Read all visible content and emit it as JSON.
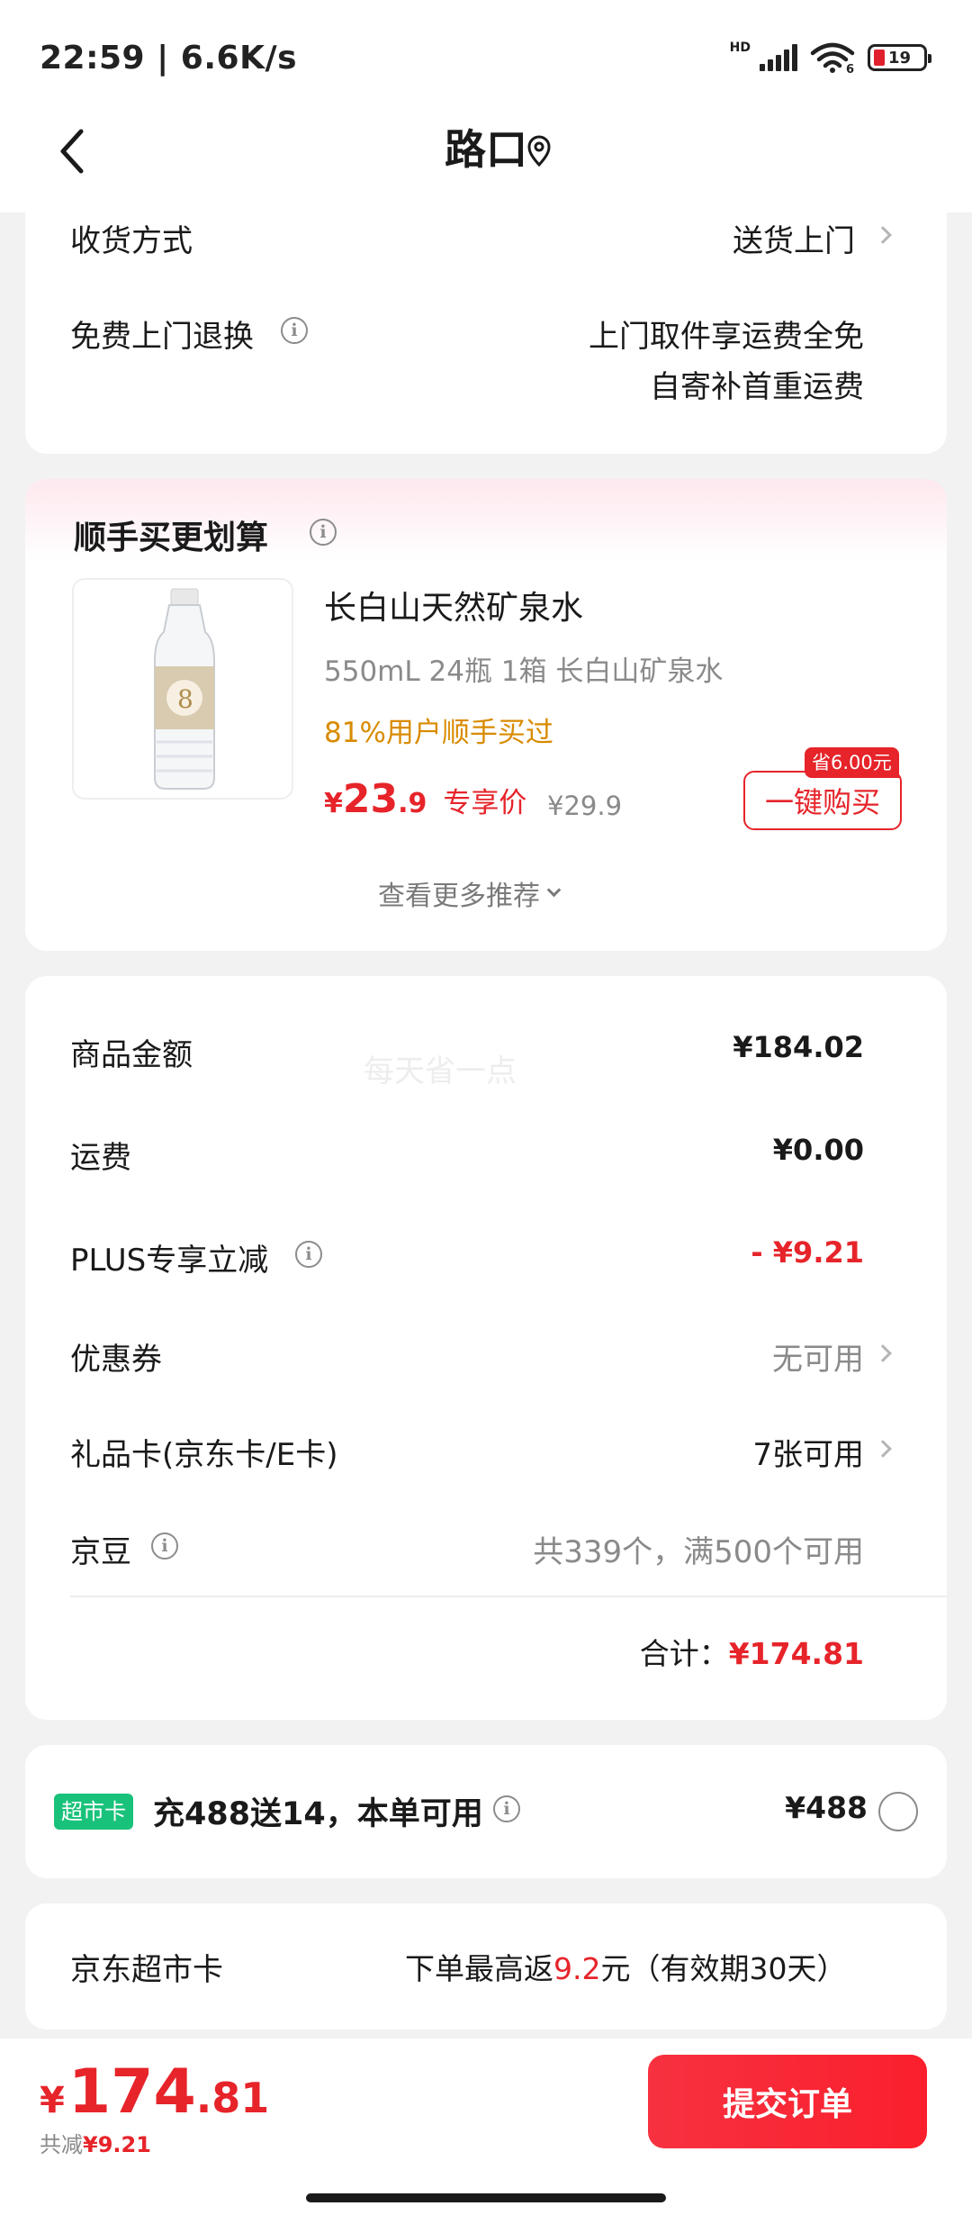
{
  "status": {
    "time": "22:59 | 6.6K/s",
    "hd": "HD",
    "battery": "19",
    "wifi_sub": "6"
  },
  "nav": {
    "title": "路口"
  },
  "delivery": {
    "method_label": "收货方式",
    "method_value": "送货上门",
    "return_label": "免费上门退换",
    "return_value_1": "上门取件享运费全免",
    "return_value_2": "自寄补首重运费"
  },
  "bundle": {
    "title": "顺手买更划算",
    "product_name": "长白山天然矿泉水",
    "product_spec": "550mL 24瓶 1箱 长白山矿泉水",
    "product_social": "81%用户顺手买过",
    "price_symbol": "¥",
    "price_int": "23",
    "price_dec": ".9",
    "price_tag": "专享价",
    "orig_price": "¥29.9",
    "save_badge": "省6.00元",
    "buy_button": "一键购买",
    "more": "查看更多推荐"
  },
  "summary": {
    "watermark": "每天省一点",
    "rows": [
      {
        "label": "商品金额",
        "value": "¥184.02"
      },
      {
        "label": "运费",
        "value": "¥0.00"
      },
      {
        "label": "PLUS专享立减",
        "value": "- ¥9.21"
      },
      {
        "label": "优惠券",
        "value": "无可用"
      },
      {
        "label": "礼品卡(京东卡/E卡)",
        "value": "7张可用"
      },
      {
        "label": "京豆",
        "value": "共339个，满500个可用"
      }
    ],
    "total_label": "合计：",
    "total_value": "¥174.81"
  },
  "supermarket": {
    "tag": "超市卡",
    "promo": "充488送14，本单可用",
    "price": "¥488",
    "card_label": "京东超市卡",
    "rebate_prefix": "下单最高返",
    "rebate_amount": "9.2",
    "rebate_suffix": "元（有效期30天）"
  },
  "footer": {
    "currency": "¥",
    "total_int": "174",
    "total_dec": ".81",
    "saved_prefix": "共减",
    "saved_amount": "¥9.21",
    "submit": "提交订单"
  },
  "colors": {
    "accent_red": "#e6242a",
    "orange": "#d98b00",
    "green_tag": "#19c27a"
  }
}
